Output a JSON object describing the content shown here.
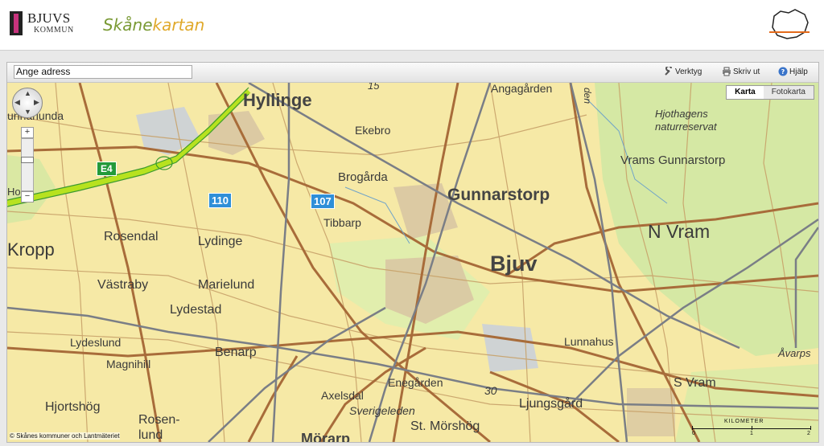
{
  "header": {
    "kommun_name": "BJUVS",
    "kommun_sub": "KOMMUN",
    "app_title_part1": "Skåne",
    "app_title_part2": "kartan",
    "brand_green": "#7a9a35",
    "brand_yellow": "#e0a92b",
    "region_icon": "skane-region-icon"
  },
  "toolbar": {
    "address_value": "Ange adress",
    "tools": [
      {
        "label": "Verktyg",
        "icon": "wrench-icon"
      },
      {
        "label": "Skriv ut",
        "icon": "printer-icon"
      },
      {
        "label": "Hjälp",
        "icon": "help-icon"
      }
    ]
  },
  "map": {
    "maptypes": [
      "Karta",
      "Fotokarta"
    ],
    "active_maptype": "Karta",
    "zoom_plus": "+",
    "zoom_minus": "−",
    "copyright": "© Skånes kommuner och Lantmäteriet",
    "scale": {
      "title": "KILOMETER",
      "ticks": [
        "0",
        "1",
        "2"
      ]
    },
    "road_shields": [
      "E4",
      "110",
      "107",
      "15",
      "30"
    ],
    "places": [
      "Hyllinge",
      "Gunnarstorp",
      "Bjuv",
      "N Vram",
      "Kropp",
      "Ekebro",
      "Brogårda",
      "Tibbarp",
      "Rosendal",
      "Lydinge",
      "Västraby",
      "Marielund",
      "Lydestad",
      "Lydeslund",
      "Magnihill",
      "Benarp",
      "Hjortshög",
      "Rosen-",
      "lund",
      "Axelsdal",
      "Enegården",
      "Sverigeleden",
      "St. Mörshög",
      "Ljungsgård",
      "Lunnahus",
      "S Vram",
      "Åvarps",
      "Vrams Gunnarstorp",
      "Hjothagens",
      "naturreservat",
      "Angagården",
      "unnarlunda",
      "Hol",
      "Mörarp",
      "den"
    ]
  }
}
